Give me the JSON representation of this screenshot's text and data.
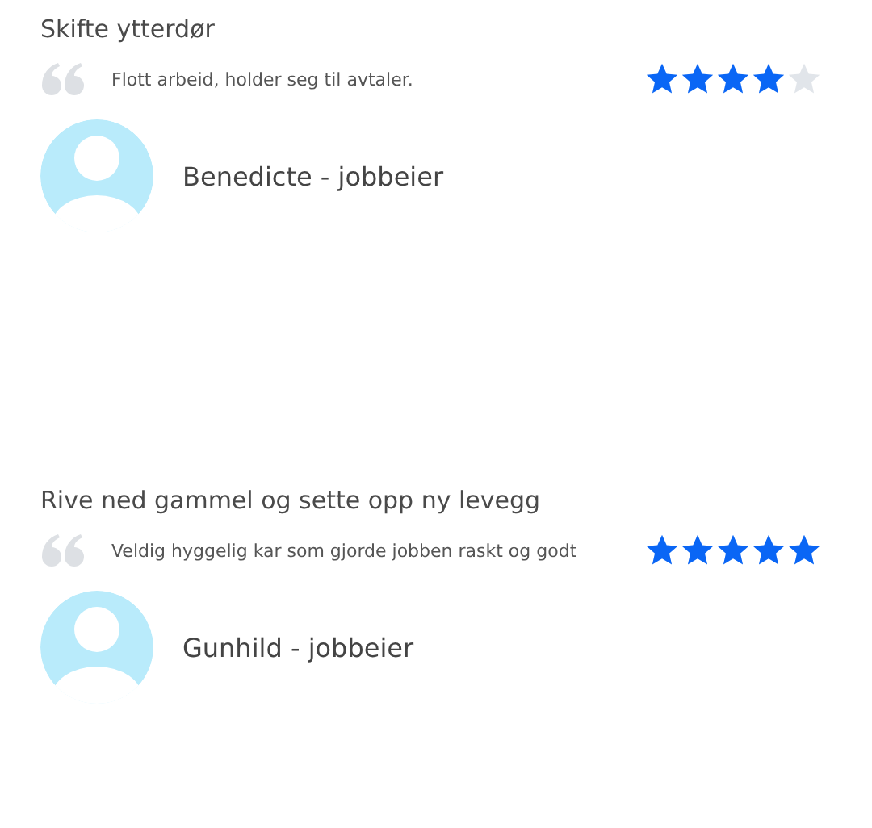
{
  "reviews": [
    {
      "title": "Skifte ytterdør",
      "comment": "Flott arbeid, holder seg til avtaler.",
      "stars": 4,
      "author": "Benedicte - jobbeier"
    },
    {
      "title": "Rive ned gammel og sette opp ny levegg",
      "comment": "Veldig hyggelig kar som gjorde jobben raskt og godt",
      "stars": 5,
      "author": "Gunhild - jobbeier"
    }
  ]
}
